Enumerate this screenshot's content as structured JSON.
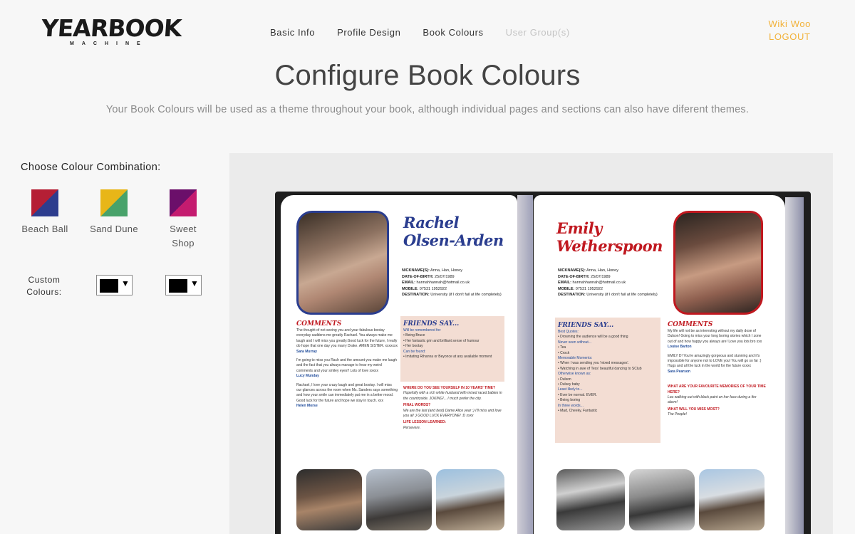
{
  "logo": {
    "main": "YEARBOOK",
    "sub": "MACHINE"
  },
  "nav": {
    "items": [
      {
        "label": "Basic Info",
        "disabled": false
      },
      {
        "label": "Profile Design",
        "disabled": false
      },
      {
        "label": "Book Colours",
        "disabled": false
      },
      {
        "label": "User Group(s)",
        "disabled": true
      }
    ]
  },
  "user": {
    "name": "Wiki Woo",
    "logout": "LOGOUT",
    "color": "#f2b23a"
  },
  "page": {
    "title": "Configure Book Colours",
    "subtitle": "Your Book Colours will be used as a theme throughout your book, although individual pages and sections can also have diferent themes."
  },
  "colours": {
    "heading": "Choose Colour Combination:",
    "combinations": [
      {
        "name": "Beach Ball",
        "colors": [
          "#b51f35",
          "#2d3d8e"
        ]
      },
      {
        "name": "Sand Dune",
        "colors": [
          "#e8b618",
          "#48a26a"
        ]
      },
      {
        "name": "Sweet Shop",
        "colors": [
          "#6b0f6a",
          "#c41b6f"
        ]
      }
    ],
    "custom_label": "Custom\nColours:",
    "custom_pickers": [
      {
        "value": "#000000"
      },
      {
        "value": "#000000"
      }
    ]
  },
  "preview": {
    "left": {
      "name_line1": "Rachel",
      "name_line2": "Olsen-Arden",
      "name_color": "#2a3d8f",
      "info": [
        {
          "label": "NICKNAME(S):",
          "value": "Anna, Han, Honey"
        },
        {
          "label": "DATE-OF-BIRTH:",
          "value": "25/07/1989"
        },
        {
          "label": "EMAIL:",
          "value": "hannahhannah@hotmail.co.uk"
        },
        {
          "label": "MOBILE:",
          "value": "07531 1952922"
        },
        {
          "label": "DESTINATION:",
          "value": "University (if I don't fail at life completely)"
        }
      ],
      "comments_title": "COMMENTS",
      "comments": [
        {
          "text": "The thought of not seeing you and your fabulous bootay everyday saddens me greatly Rachael. You always make me laugh and I will miss you greatly.Good luck for the future, I really do hope that one day you marry Drake. AMEN SISTER. xxxxxxx",
          "author": "Sara Murray"
        },
        {
          "text": "I'm going to miss you Rach and the amount you make me laugh and the fact that you always manage to hear my weird comments and your smiley eyes!! Lots of love xxxxx",
          "author": "Lucy Munday"
        },
        {
          "text": "Rachael, I love your crazy laugh and great bootay. I will miss our glances across the room when Ms. Sanders says something and how your smile can immediately put me in a better mood. Good luck for the future and hope we stay in touch. xxx",
          "author": "Helen Morse"
        }
      ],
      "friends_title": "FRIENDS SAY...",
      "friends": [
        {
          "h": "Will be remembered for:",
          "items": [
            "Being Bruce",
            "Her fantastic grin and brilliant sense of humour",
            "Her bootay"
          ]
        },
        {
          "h": "Can be found:",
          "items": [
            "Imitating Rihanna or Beyonce at any available moment"
          ]
        }
      ],
      "qa": [
        {
          "q": "WHERE DO YOU SEE YOURSELF IN 10 YEARS' TIME?",
          "a": "Hopefully with a rich white husband with mixed raced babies in the countryside. JOKING!... I much prefer the city."
        },
        {
          "q": "FINAL WORDS?",
          "a": "We are the last (and best) Dame Alice year :) I'll miss and love you all :) GOOD LUCK EVERYONE! :D xxxx"
        },
        {
          "q": "LIFE LESSON LEARNED:",
          "a": "Persevere."
        }
      ]
    },
    "right": {
      "name_line1": "Emily",
      "name_line2": "Wetherspoon",
      "name_color": "#c0181f",
      "info": [
        {
          "label": "NICKNAME(S):",
          "value": "Anna, Han, Honey"
        },
        {
          "label": "DATE-OF-BIRTH:",
          "value": "25/07/1989"
        },
        {
          "label": "EMAIL:",
          "value": "hannahhannah@hotmail.co.uk"
        },
        {
          "label": "MOBILE:",
          "value": "07531 1952922"
        },
        {
          "label": "DESTINATION:",
          "value": "University (if I don't fail at life completely)"
        }
      ],
      "friends_title": "FRIENDS SAY...",
      "friends": [
        {
          "h": "Best Quotes:",
          "items": [
            "Drowning the audience will be a good thing"
          ]
        },
        {
          "h": "Never seen without...",
          "items": [
            "Tea",
            "Crock"
          ]
        },
        {
          "h": "Memorable Moments:",
          "items": [
            "When I was sending you 'mixed messages'.",
            "Watching in awe of Tess' beautiful dancing to SClub"
          ]
        },
        {
          "h": "Otherwise known as:",
          "items": [
            "Dulson",
            "Dulsey baby"
          ]
        },
        {
          "h": "Least likely to...",
          "items": [
            "Ever be normal. EVER.",
            "Being boring"
          ]
        },
        {
          "h": "In three words...",
          "items": [
            "Mad, Cheeky, Fantastic"
          ]
        }
      ],
      "comments_title": "COMMENTS",
      "comments": [
        {
          "text": "My life will not be as interesting without my daily dose of Dulson! Going to miss your long boring stories which I zone out of and how happy you always are! Love you lots bro xxx",
          "author": "Louise Barton"
        },
        {
          "text": "EMILY D! You're amazingly gorgeous and stunning and it's impossible for anyone not to LOVE you! You will go so far :) Hugs and all the luck in the world for the future xxxxx",
          "author": "Sara Pearson"
        }
      ],
      "qa": [
        {
          "q": "WHAT ARE YOUR FAVOURITE MEMORIES OF YOUR TIME HERE?",
          "a": "Lou walking out with black paint on her face during a fire alarm!"
        },
        {
          "q": "WHAT WILL YOU MISS MOST?",
          "a": "The People!"
        }
      ]
    }
  }
}
